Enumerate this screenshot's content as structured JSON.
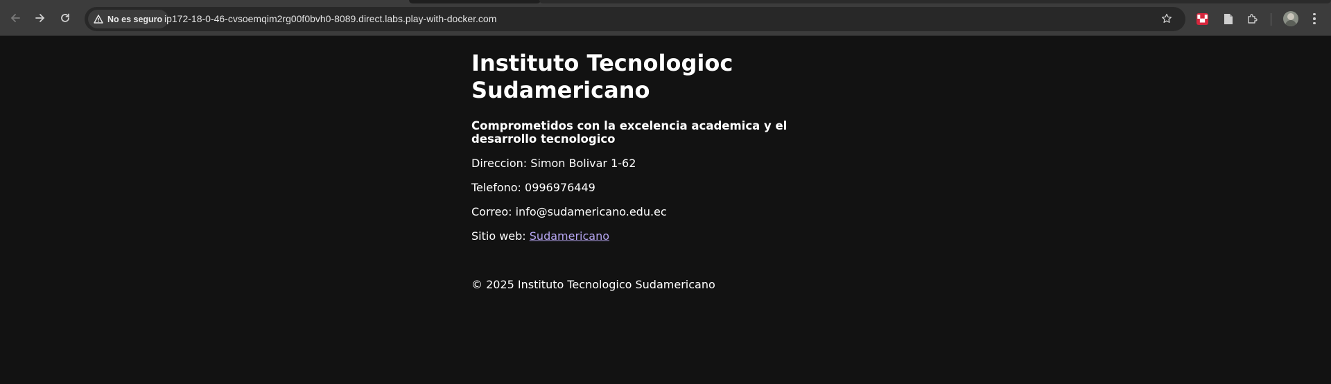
{
  "browser": {
    "security_label": "No es seguro",
    "url": "ip172-18-0-46-cvsoemqim2rg00f0bvh0-8089.direct.labs.play-with-docker.com",
    "icons": {
      "back": "arrow-left-icon",
      "forward": "arrow-right-icon",
      "reload": "reload-icon",
      "security": "warning-triangle-icon",
      "bookmark": "star-icon",
      "extensions": "puzzle-icon",
      "menu": "kebab-menu-icon"
    }
  },
  "page": {
    "title": "Instituto Tecnologioc Sudamericano",
    "tagline": "Comprometidos con la excelencia academica y el desarrollo tecnologico",
    "direccion": "Direccion: Simon Bolivar 1-62",
    "telefono": "Telefono: 0996976449",
    "correo": "Correo: info@sudamericano.edu.ec",
    "sitio_label": "Sitio web: ",
    "sitio_link": "Sudamericano",
    "footer": "© 2025 Instituto Tecnologico Sudamericano"
  },
  "colors": {
    "page_background": "#121212",
    "link": "#b7a6f2",
    "toolbar": "#3c3c3c"
  }
}
